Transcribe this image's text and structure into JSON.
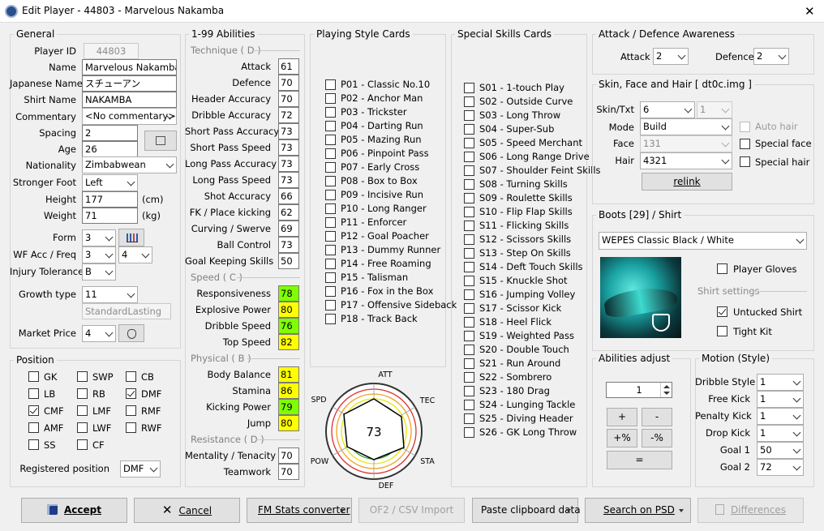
{
  "window": {
    "title": "Edit Player - 44803 - Marvelous Nakamba",
    "close": "✕"
  },
  "general": {
    "title": "General",
    "player_id_label": "Player ID",
    "player_id": "44803",
    "name_label": "Name",
    "name": "Marvelous Nakamba",
    "jp_label": "Japanese Name",
    "jp_name": "スチューアン",
    "shirt_label": "Shirt Name",
    "shirt_name": "NAKAMBA",
    "commentary_label": "Commentary",
    "commentary": "<No commentary>",
    "spacing_label": "Spacing",
    "spacing": "2",
    "age_label": "Age",
    "age": "26",
    "nationality_label": "Nationality",
    "nationality": "Zimbabwean",
    "foot_label": "Stronger Foot",
    "foot": "Left",
    "height_label": "Height",
    "height": "177",
    "height_unit": "(cm)",
    "weight_label": "Weight",
    "weight": "71",
    "weight_unit": "(kg)",
    "form_label": "Form",
    "form": "3",
    "wf_label": "WF Acc / Freq",
    "wf_acc": "3",
    "wf_freq": "4",
    "injury_label": "Injury Tolerance",
    "injury": "B",
    "growth_label": "Growth type",
    "growth": "11",
    "growth_name": "StandardLasting",
    "market_label": "Market Price",
    "market": "4"
  },
  "position": {
    "title": "Position",
    "items": [
      {
        "label": "GK",
        "checked": false
      },
      {
        "label": "SWP",
        "checked": false
      },
      {
        "label": "CB",
        "checked": false
      },
      {
        "label": "LB",
        "checked": false
      },
      {
        "label": "RB",
        "checked": false
      },
      {
        "label": "DMF",
        "checked": true
      },
      {
        "label": "CMF",
        "checked": true
      },
      {
        "label": "LMF",
        "checked": false
      },
      {
        "label": "RMF",
        "checked": false
      },
      {
        "label": "AMF",
        "checked": false
      },
      {
        "label": "LWF",
        "checked": false
      },
      {
        "label": "RWF",
        "checked": false
      },
      {
        "label": "SS",
        "checked": false
      },
      {
        "label": "CF",
        "checked": false
      }
    ],
    "registered_label": "Registered position",
    "registered": "DMF"
  },
  "abilities": {
    "title": "1-99 Abilities",
    "technique_title": "Technique ( D )",
    "technique": [
      {
        "label": "Attack",
        "value": "61"
      },
      {
        "label": "Defence",
        "value": "70"
      },
      {
        "label": "Header Accuracy",
        "value": "70"
      },
      {
        "label": "Dribble Accuracy",
        "value": "72"
      },
      {
        "label": "Short Pass Accuracy",
        "value": "73"
      },
      {
        "label": "Short Pass Speed",
        "value": "73"
      },
      {
        "label": "Long Pass Accuracy",
        "value": "73"
      },
      {
        "label": "Long Pass Speed",
        "value": "73"
      },
      {
        "label": "Shot Accuracy",
        "value": "66"
      },
      {
        "label": "FK / Place kicking",
        "value": "62"
      },
      {
        "label": "Curving / Swerve",
        "value": "69"
      },
      {
        "label": "Ball Control",
        "value": "73"
      },
      {
        "label": "Goal Keeping Skills",
        "value": "50"
      }
    ],
    "speed_title": "Speed ( C )",
    "speed": [
      {
        "label": "Responsiveness",
        "value": "78",
        "color": "#7fff00"
      },
      {
        "label": "Explosive Power",
        "value": "80",
        "color": "#ffff00"
      },
      {
        "label": "Dribble Speed",
        "value": "76",
        "color": "#7fff00"
      },
      {
        "label": "Top Speed",
        "value": "82",
        "color": "#ffff00"
      }
    ],
    "physical_title": "Physical ( B )",
    "physical": [
      {
        "label": "Body Balance",
        "value": "81",
        "color": "#ffff00"
      },
      {
        "label": "Stamina",
        "value": "86",
        "color": "#ffff00"
      },
      {
        "label": "Kicking Power",
        "value": "79",
        "color": "#7fff00"
      },
      {
        "label": "Jump",
        "value": "80",
        "color": "#ffff00"
      }
    ],
    "resistance_title": "Resistance ( D )",
    "resistance": [
      {
        "label": "Mentality / Tenacity",
        "value": "70"
      },
      {
        "label": "Teamwork",
        "value": "70"
      }
    ]
  },
  "playing_style": {
    "title": "Playing Style Cards",
    "cards": [
      "P01 - Classic No.10",
      "P02 - Anchor Man",
      "P03 - Trickster",
      "P04 - Darting Run",
      "P05 - Mazing Run",
      "P06 - Pinpoint Pass",
      "P07 - Early Cross",
      "P08 - Box to Box",
      "P09 - Incisive Run",
      "P10 - Long Ranger",
      "P11 - Enforcer",
      "P12 - Goal Poacher",
      "P13 - Dummy Runner",
      "P14 - Free Roaming",
      "P15 - Talisman",
      "P16 - Fox in the Box",
      "P17 - Offensive Sideback",
      "P18 - Track Back"
    ]
  },
  "radar": {
    "overall": "73",
    "axes": [
      "ATT",
      "TEC",
      "STA",
      "DEF",
      "POW",
      "SPD"
    ]
  },
  "special_skills": {
    "title": "Special Skills Cards",
    "cards": [
      "S01 - 1-touch Play",
      "S02 - Outside Curve",
      "S03 - Long Throw",
      "S04 - Super-Sub",
      "S05 - Speed Merchant",
      "S06 - Long Range Drive",
      "S07 - Shoulder Feint Skills",
      "S08 - Turning Skills",
      "S09 - Roulette Skills",
      "S10 - Flip Flap Skills",
      "S11 - Flicking Skills",
      "S12 - Scissors Skills",
      "S13 - Step On Skills",
      "S14 - Deft Touch Skills",
      "S15 - Knuckle Shot",
      "S16 - Jumping Volley",
      "S17 - Scissor Kick",
      "S18 - Heel Flick",
      "S19 - Weighted Pass",
      "S20 - Double Touch",
      "S21 - Run Around",
      "S22 - Sombrero",
      "S23 - 180 Drag",
      "S24 - Lunging Tackle",
      "S25 - Diving Header",
      "S26 - GK Long Throw"
    ]
  },
  "awareness": {
    "title": "Attack / Defence Awareness",
    "attack_label": "Attack",
    "attack": "2",
    "defence_label": "Defence",
    "defence": "2"
  },
  "skin": {
    "title": "Skin, Face and Hair [ dt0c.img ]",
    "skin_label": "Skin/Txt",
    "skin": "6",
    "txt": "1",
    "mode_label": "Mode",
    "mode": "Build",
    "face_label": "Face",
    "face": "131",
    "hair_label": "Hair",
    "hair": "4321",
    "relink": "relink",
    "auto_hair": "Auto hair",
    "special_face": "Special face",
    "special_hair": "Special hair"
  },
  "boots": {
    "title": "Boots [29] / Shirt",
    "boot": "WEPES Classic Black / White",
    "player_gloves": "Player Gloves",
    "shirt_settings": "Shirt settings",
    "untucked": "Untucked Shirt",
    "tight": "Tight Kit"
  },
  "adjust": {
    "title": "Abilities adjust",
    "value": "1",
    "plus": "+",
    "minus": "-",
    "plus_pct": "+%",
    "minus_pct": "-%",
    "equal": "="
  },
  "motion": {
    "title": "Motion (Style)",
    "items": [
      {
        "label": "Dribble Style",
        "value": "1"
      },
      {
        "label": "Free Kick",
        "value": "1"
      },
      {
        "label": "Penalty Kick",
        "value": "1"
      },
      {
        "label": "Drop Kick",
        "value": "1"
      },
      {
        "label": "Goal 1",
        "value": "50"
      },
      {
        "label": "Goal 2",
        "value": "72"
      }
    ]
  },
  "footer": {
    "accept": "Accept",
    "cancel": "Cancel",
    "fm_stats": "FM Stats converter",
    "of2_import": "OF2 / CSV Import",
    "paste": "Paste clipboard data",
    "search_psd": "Search on PSD",
    "differences": "Differences"
  }
}
